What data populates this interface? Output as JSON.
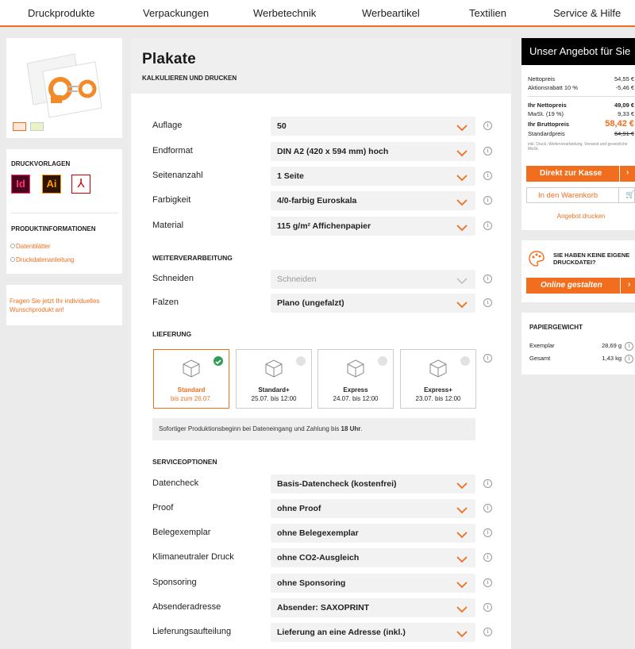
{
  "nav": [
    "Druckprodukte",
    "Verpackungen",
    "Werbetechnik",
    "Werbeartikel",
    "Textilien",
    "Service & Hilfe"
  ],
  "left": {
    "druckvorlagen_title": "DRUCKVORLAGEN",
    "file_icons": [
      "Id",
      "Ai"
    ],
    "produktinfo_title": "PRODUKTINFORMATIONEN",
    "links": [
      "Datenblätter",
      "Druckdatenanleitung"
    ],
    "cta": "Fragen Sie jetzt Ihr individuelles Wunschprodukt an!"
  },
  "main": {
    "title": "Plakate",
    "subtitle": "KALKULIEREN UND DRUCKEN",
    "rows1": [
      {
        "label": "Auflage",
        "value": "50"
      },
      {
        "label": "Endformat",
        "value": "DIN A2 (420 x 594 mm) hoch"
      },
      {
        "label": "Seitenanzahl",
        "value": "1 Seite"
      },
      {
        "label": "Farbigkeit",
        "value": "4/0-farbig Euroskala"
      },
      {
        "label": "Material",
        "value": "115 g/m² Affichenpapier"
      }
    ],
    "weiterverarbeitung_title": "WEITERVERARBEITUNG",
    "rows2": [
      {
        "label": "Schneiden",
        "value": "Schneiden",
        "disabled": true
      },
      {
        "label": "Falzen",
        "value": "Plano (ungefalzt)"
      }
    ],
    "lieferung_title": "LIEFERUNG",
    "delivery": [
      {
        "name": "Standard",
        "date": "bis zum 26.07.",
        "selected": true
      },
      {
        "name": "Standard+",
        "date": "25.07. bis 12:00",
        "selected": false
      },
      {
        "name": "Express",
        "date": "24.07. bis 12:00",
        "selected": false
      },
      {
        "name": "Express+",
        "date": "23.07. bis 12:00",
        "selected": false
      }
    ],
    "notice_text": "Sofortiger Produktionsbeginn bei Dateneingang und Zahlung bis ",
    "notice_bold": "18 Uhr",
    "notice_end": ".",
    "serviceoptionen_title": "SERVICEOPTIONEN",
    "rows3": [
      {
        "label": "Datencheck",
        "value": "Basis-Datencheck (kostenfrei)"
      },
      {
        "label": "Proof",
        "value": "ohne Proof"
      },
      {
        "label": "Belegexemplar",
        "value": "ohne Belegexemplar"
      },
      {
        "label": "Klimaneutraler Druck",
        "value": "ohne CO2-Ausgleich"
      },
      {
        "label": "Sponsoring",
        "value": "ohne Sponsoring"
      },
      {
        "label": "Absenderadresse",
        "value": "Absender: SAXOPRINT"
      },
      {
        "label": "Lieferungsaufteilung",
        "value": "Lieferung an eine Adresse (inkl.)"
      }
    ]
  },
  "offer": {
    "title": "Unser Angebot für Sie",
    "nettopreis_label": "Nettopreis",
    "nettopreis": "54,55 €",
    "rabatt_label": "Aktionsrabatt  10 %",
    "rabatt": "-5,46 €",
    "ihr_netto_label": "Ihr Nettopreis",
    "ihr_netto": "49,09 €",
    "mwst_label": "MwSt. (19 %)",
    "mwst": "9,33 €",
    "brutto_label": "Ihr Bruttopreis",
    "brutto": "58,42 €",
    "standard_label": "Standardpreis",
    "standard": "64,91 €",
    "note": "inkl. Druck, Weiterverarbeitung, Versand und gesetzliche MwSt.",
    "checkout_btn": "Direkt zur Kasse",
    "cart_btn": "In den Warenkorb",
    "print_link": "Angebot drucken"
  },
  "design": {
    "title": "SIE HABEN KEINE EIGENE DRUCKDATEI?",
    "btn": "Online gestalten"
  },
  "paper": {
    "title": "PAPIERGEWICHT",
    "rows": [
      {
        "label": "Exemplar",
        "value": "28,69 g"
      },
      {
        "label": "Gesamt",
        "value": "1,43 kg"
      }
    ]
  },
  "colors": {
    "accent": "#f06e1e",
    "dark": "#000000",
    "bg": "#ebebeb",
    "check": "#2e9e55"
  }
}
